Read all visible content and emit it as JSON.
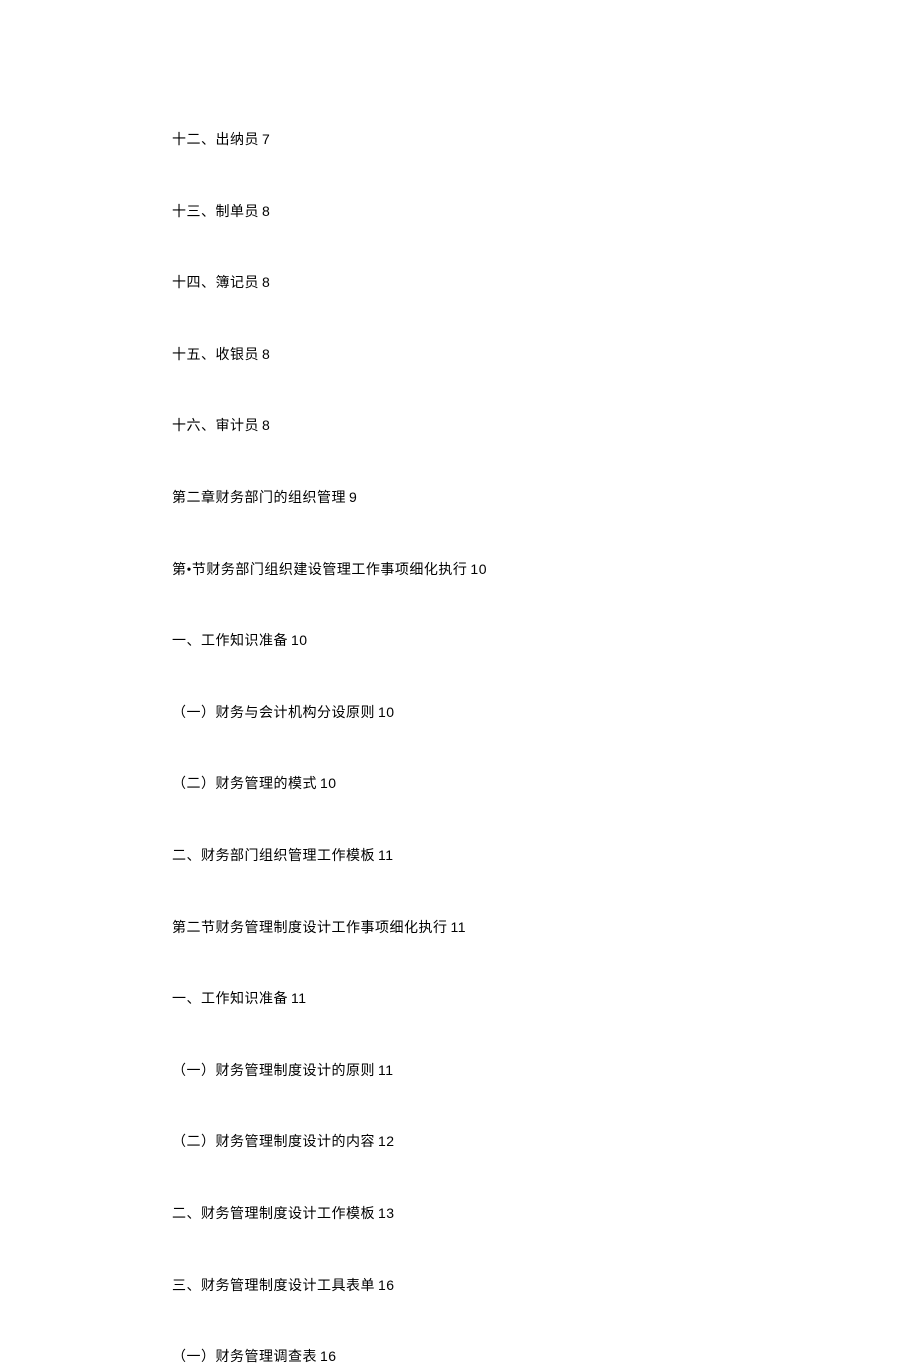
{
  "toc": {
    "items": [
      {
        "text": "十二、出纳员",
        "page": "7"
      },
      {
        "text": "十三、制单员",
        "page": "8"
      },
      {
        "text": "十四、簿记员",
        "page": "8"
      },
      {
        "text": "十五、收银员",
        "page": "8"
      },
      {
        "text": "十六、审计员",
        "page": "8"
      },
      {
        "text": "第二章财务部门的组织管理",
        "page": "9"
      },
      {
        "text": "第•节财务部门组织建设管理工作事项细化执行",
        "page": "10"
      },
      {
        "text": "一、工作知识准备",
        "page": "10"
      },
      {
        "text": "（一）财务与会计机构分设原则",
        "page": "10"
      },
      {
        "text": "（二）财务管理的模式",
        "page": "10"
      },
      {
        "text": "二、财务部门组织管理工作模板",
        "page": "11"
      },
      {
        "text": "第二节财务管理制度设计工作事项细化执行",
        "page": "11"
      },
      {
        "text": "一、工作知识准备",
        "page": "11"
      },
      {
        "text": "（一）财务管理制度设计的原则",
        "page": "11"
      },
      {
        "text": "（二）财务管理制度设计的内容",
        "page": "12"
      },
      {
        "text": "二、财务管理制度设计工作模板",
        "page": "13"
      },
      {
        "text": "三、财务管理制度设计工具表单",
        "page": "16"
      },
      {
        "text": "（一）财务管理调查表",
        "page": "16"
      }
    ]
  }
}
